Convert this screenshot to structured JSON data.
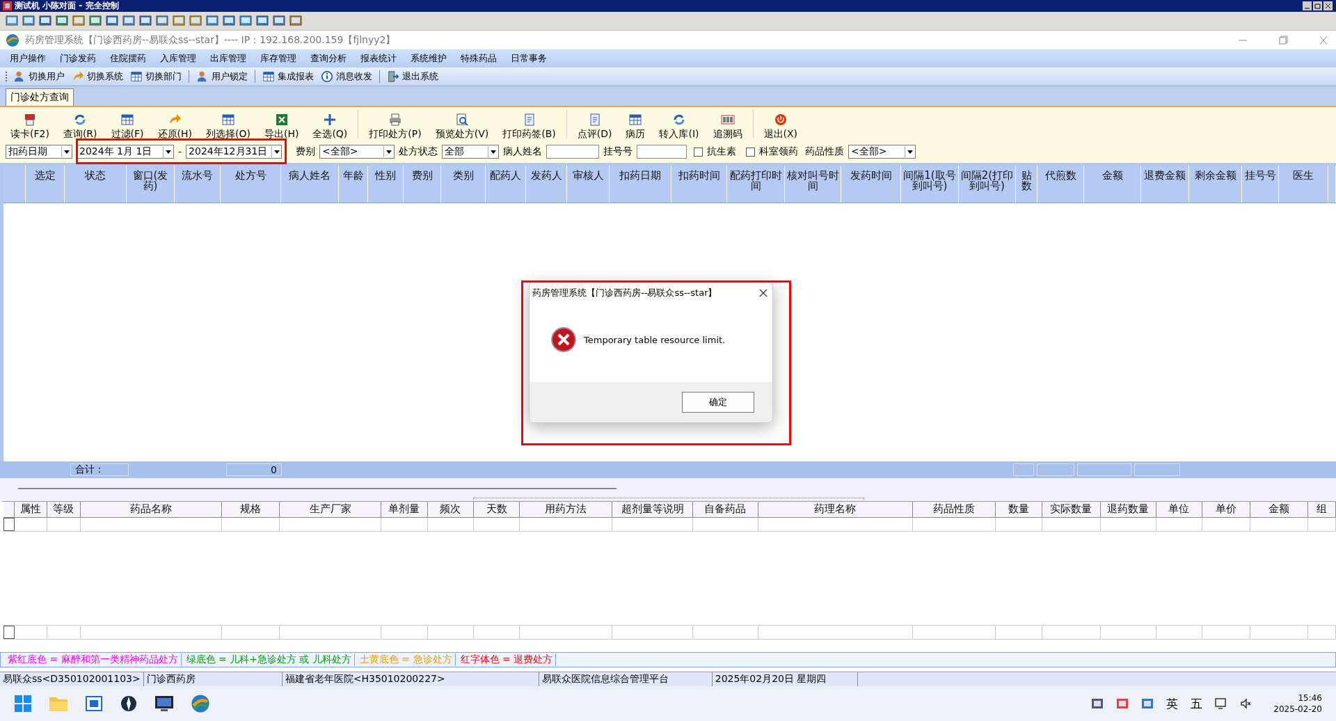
{
  "remote_bar": {
    "title": "测试机 小陈对面 - 完全控制"
  },
  "window": {
    "title": "药房管理系统【门诊西药房--易联众ss--star】---- IP：192.168.200.159【fjlnyy2】"
  },
  "menu": [
    "用户操作",
    "门诊发药",
    "住院摆药",
    "入库管理",
    "出库管理",
    "库存管理",
    "查询分析",
    "报表统计",
    "系统维护",
    "特殊药品",
    "日常事务"
  ],
  "toolbar": [
    {
      "label": "切换用户",
      "kind": "user"
    },
    {
      "label": "切换系统",
      "kind": "arrow"
    },
    {
      "label": "切换部门",
      "kind": "grid"
    },
    {
      "label": "用户锁定",
      "kind": "user",
      "sep": true
    },
    {
      "label": "集成报表",
      "kind": "grid",
      "sep": true
    },
    {
      "label": "消息收发",
      "kind": "info"
    },
    {
      "label": "退出系统",
      "kind": "door",
      "sep": true
    }
  ],
  "tabs": [
    {
      "label": "门诊处方查询",
      "selected": true
    }
  ],
  "actions": [
    {
      "label": "读卡(F2)",
      "kind": "card"
    },
    {
      "label": "查询(R)",
      "kind": "refresh"
    },
    {
      "label": "过滤(F)",
      "kind": "grid"
    },
    {
      "label": "还原(H)",
      "kind": "arrow"
    },
    {
      "label": "列选择(O)",
      "kind": "grid"
    },
    {
      "label": "导出(H)",
      "kind": "sheet"
    },
    {
      "label": "全选(Q)",
      "kind": "plus"
    },
    {
      "label": "打印处方(P)",
      "kind": "printer",
      "sep": true
    },
    {
      "label": "预览处方(V)",
      "kind": "search"
    },
    {
      "label": "打印药签(B)",
      "kind": "doc"
    },
    {
      "label": "点评(D)",
      "kind": "doc",
      "sep": true
    },
    {
      "label": "病历",
      "kind": "grid"
    },
    {
      "label": "转入库(I)",
      "kind": "refresh"
    },
    {
      "label": "追溯码",
      "kind": "barcode"
    },
    {
      "label": "退出(X)",
      "kind": "power",
      "sep": true
    }
  ],
  "filters": [
    {
      "kind": "select",
      "value": "扣药日期"
    },
    {
      "kind": "date",
      "value": "2024年 1月 1日"
    },
    {
      "kind": "text",
      "label": "-"
    },
    {
      "kind": "date",
      "value": "2024年12月31日"
    },
    {
      "kind": "label",
      "label": "费别"
    },
    {
      "kind": "select",
      "value": "<全部>"
    },
    {
      "kind": "label",
      "label": "处方状态"
    },
    {
      "kind": "select",
      "value": "全部"
    },
    {
      "kind": "label",
      "label": "病人姓名"
    },
    {
      "kind": "input"
    },
    {
      "kind": "label",
      "label": "挂号号"
    },
    {
      "kind": "input"
    },
    {
      "kind": "checkbox",
      "label": "抗生素",
      "checked": false
    },
    {
      "kind": "checkbox",
      "label": "科室领药",
      "checked": false
    },
    {
      "kind": "label",
      "label": "药品性质"
    },
    {
      "kind": "select",
      "value": "<全部>"
    }
  ],
  "upper_table": {
    "columns": [
      "选定",
      "状态",
      "窗口(发药)",
      "流水号",
      "处方号",
      "病人姓名",
      "年龄",
      "性别",
      "费别",
      "类别",
      "配药人",
      "发药人",
      "审核人",
      "扣药日期",
      "扣药时间",
      "配药打印时间",
      "核对叫号时间",
      "发药时间",
      "间隔1(取号到叫号)",
      "间隔2(打印到叫号)",
      "贴数",
      "代煎数",
      "金额",
      "退费金额",
      "剩余金额",
      "挂号号",
      "医生"
    ]
  },
  "summary": {
    "label": "合计：",
    "value": "0"
  },
  "lower_table": {
    "columns": [
      "属性",
      "等级",
      "药品名称",
      "规格",
      "生产厂家",
      "单剂量",
      "频次",
      "天数",
      "用药方法",
      "超剂量等说明",
      "自备药品",
      "药理名称",
      "药品性质",
      "数量",
      "实际数量",
      "退药数量",
      "单位",
      "单价",
      "金额",
      "组"
    ]
  },
  "legend": [
    {
      "text": "紫红底色 = 麻醉和第一类精神药品处方",
      "color": "#ff00ff"
    },
    {
      "text": "绿底色 = 儿科+急诊处方 或 儿科处方",
      "color": "#00a000"
    },
    {
      "text": "土黄底色 = 急诊处方",
      "color": "#e8a000"
    },
    {
      "text": "红字体色 = 退费处方",
      "color": "#ff0000"
    }
  ],
  "status_bar": [
    "易联众ss<D350102001103>",
    "门诊西药房",
    "福建省老年医院<H35010200227>",
    "易联众医院信息综合管理平台",
    "2025年02月20日 星期四"
  ],
  "dialog": {
    "title": "药房管理系统【门诊西药房--易联众ss--star】",
    "message": "Temporary table resource limit.",
    "button": "确定"
  },
  "highlights": [
    {
      "kind": "frame"
    },
    {
      "kind": "frame"
    }
  ],
  "taskbar": {
    "tray": [
      {
        "kind": "icon"
      },
      {
        "kind": "icon"
      },
      {
        "kind": "icon"
      },
      {
        "kind": "text",
        "label": "英"
      },
      {
        "kind": "text",
        "label": "五"
      }
    ],
    "time": "15:46",
    "date": "2025-02-20"
  }
}
